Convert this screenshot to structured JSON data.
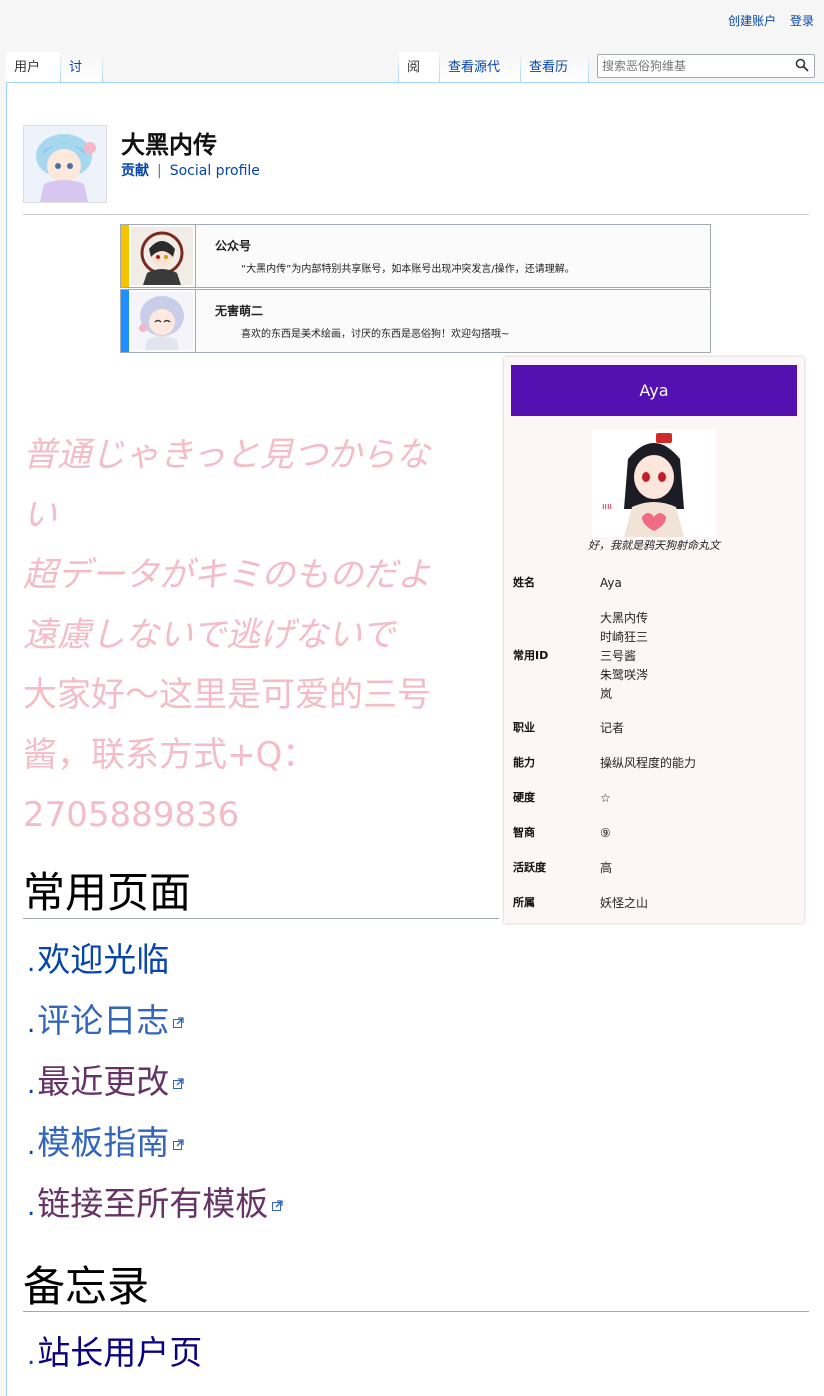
{
  "personal": {
    "create_account": "创建账户",
    "login": "登录"
  },
  "tabs": {
    "user_page": "用户页",
    "talk": "讨论",
    "read": "阅读",
    "view_source": "查看源代码",
    "history": "查看历史"
  },
  "search": {
    "placeholder": "搜索恶俗狗维基"
  },
  "user": {
    "name": "大黑内传",
    "contributions": "贡献",
    "separator": "|",
    "social_profile": "Social profile"
  },
  "notices": [
    {
      "title": "公众号",
      "text": "“大黑内传”为内部特别共享账号，如本账号出现冲突发言/操作，还请理解。",
      "bar_color": "#f5c400"
    },
    {
      "title": "无害萌二",
      "text": "喜欢的东西是美术绘画，讨厌的东西是恶俗狗！欢迎勾搭哦~",
      "bar_color": "#1e90ff"
    }
  ],
  "infobox": {
    "header": "Aya",
    "caption": "好，我就是鸦天狗射命丸文",
    "accent": "#5410b0",
    "rows": [
      {
        "key": "姓名",
        "value": [
          "Aya"
        ]
      },
      {
        "key": "常用ID",
        "value": [
          "大黑内传",
          "时崎狂三",
          "三号酱",
          "朱鹭咲涔",
          "岚"
        ]
      },
      {
        "key": "职业",
        "value": [
          "记者"
        ]
      },
      {
        "key": "能力",
        "value": [
          "操纵风程度的能力"
        ]
      },
      {
        "key": "硬度",
        "value": [
          "☆"
        ]
      },
      {
        "key": "智商",
        "value": [
          "⑨"
        ]
      },
      {
        "key": "活跃度",
        "value": [
          "高"
        ]
      },
      {
        "key": "所属",
        "value": [
          "妖怪之山"
        ]
      }
    ]
  },
  "lyrics": {
    "line1": "普通じゃきっと見つからな",
    "line2": "い",
    "line3": "超データがキミのものだよ",
    "line4": "遠慮しないで逃げないで",
    "line5": "大家好～这里是可爱的三号",
    "line6": "酱，联系方式+Q：",
    "line7": "2705889836"
  },
  "sections": {
    "common_pages": "常用页面",
    "memo": "备忘录"
  },
  "common_links": [
    {
      "label": "欢迎光临",
      "external": false,
      "color": "#0645ad"
    },
    {
      "label": "评论日志",
      "external": true,
      "color": "#3366bb"
    },
    {
      "label": "最近更改",
      "external": true,
      "color": "#663366"
    },
    {
      "label": "模板指南",
      "external": true,
      "color": "#3366bb"
    },
    {
      "label": "链接至所有模板",
      "external": true,
      "color": "#663366"
    }
  ],
  "memo_links": [
    {
      "label": "站长用户页",
      "color": "#0b0080"
    }
  ],
  "icons": {
    "search": "search-icon",
    "external_link": "external-link-icon"
  }
}
